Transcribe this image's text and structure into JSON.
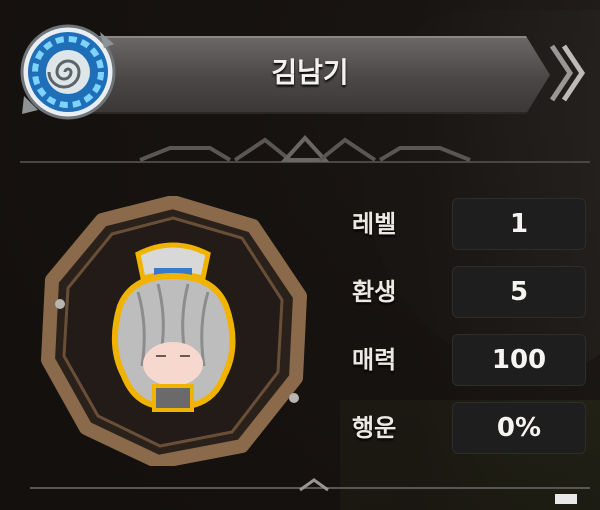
{
  "character": {
    "name": "김남기"
  },
  "stats": [
    {
      "label": "레벨",
      "value": "1"
    },
    {
      "label": "환생",
      "value": "5"
    },
    {
      "label": "매력",
      "value": "100"
    },
    {
      "label": "행운",
      "value": "0%"
    }
  ],
  "icons": {
    "emblem": "spiral-emblem-icon",
    "portrait": "character-portrait",
    "chevrons": "double-chevron-right-icon"
  },
  "colors": {
    "emblem_blue": "#36a7f0",
    "portrait_outline": "#f0b400",
    "frame_wood": "#8a6a4a"
  }
}
